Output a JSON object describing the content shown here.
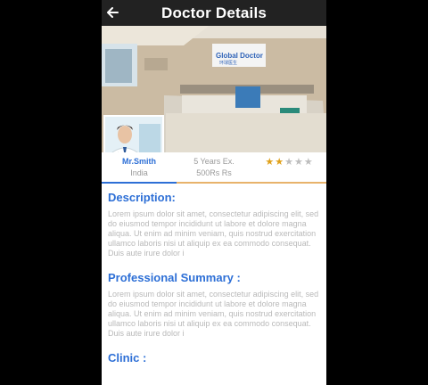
{
  "header": {
    "title": "Doctor Details",
    "back_icon": "arrow-back-icon"
  },
  "hero": {
    "clinic_sign": "Global Doctor",
    "clinic_sign_sub": "环球医生"
  },
  "doctor": {
    "name": "Mr.Smith",
    "location": "India",
    "experience": "5 Years Ex.",
    "fee": "500Rs Rs",
    "rating": 2,
    "max_rating": 5,
    "star_filled_color": "#e0a11a",
    "star_empty_color": "#bdbdbd"
  },
  "sections": {
    "description": {
      "title": "Description:",
      "text": "Lorem ipsum dolor sit amet, consectetur adipiscing elit, sed do eiusmod tempor incididunt ut labore et dolore magna aliqua. Ut enim ad minim veniam, quis nostrud exercitation ullamco laboris nisi ut aliquip ex ea commodo consequat. Duis aute irure dolor i"
    },
    "summary": {
      "title": "Professional Summary :",
      "text": "Lorem ipsum dolor sit amet, consectetur adipiscing elit, sed do eiusmod tempor incididunt ut labore et dolore magna aliqua. Ut enim ad minim veniam, quis nostrud exercitation ullamco laboris nisi ut aliquip ex ea commodo consequat. Duis aute irure dolor i"
    },
    "clinic": {
      "title": "Clinic :"
    }
  },
  "colors": {
    "appbar": "#222222",
    "accent": "#2d6fd6",
    "divider": "#e8b36b"
  }
}
